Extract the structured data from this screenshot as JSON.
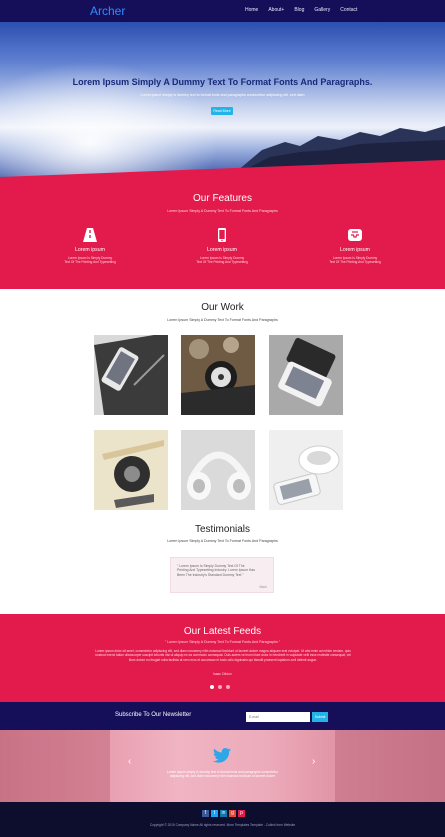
{
  "nav": {
    "logo": "Archer",
    "items": [
      "Home",
      "About+",
      "Blog",
      "Gallery",
      "Contact"
    ]
  },
  "hero": {
    "title": "Lorem Ipsum Simply A Dummy Text To Format Fonts And Paragraphs.",
    "subtitle": "Lorem ipsum simply is dummy text to format fonts and paragraphs consectetur adipiscing elit, sed diam",
    "button": "Read More"
  },
  "features": {
    "title": "Our Features",
    "subtitle": "Lorem Ipsum Simply A Dummy Text To Format Fonts And Paragraphs",
    "items": [
      {
        "icon": "road-icon",
        "title": "Lorem ipsum",
        "desc_line1": "Lorem Ipsum Is Simply Dummy",
        "desc_line2": "Text Of The Printing And Typesetting"
      },
      {
        "icon": "mobile-icon",
        "title": "Lorem ipsum",
        "desc_line1": "Lorem Ipsum Is Simply Dummy",
        "desc_line2": "Text Of The Printing And Typesetting"
      },
      {
        "icon": "inbox-icon",
        "title": "Lorem ipsum",
        "desc_line1": "Lorem Ipsum Is Simply Dummy",
        "desc_line2": "Text Of The Printing And Typesetting"
      }
    ]
  },
  "work": {
    "title": "Our Work",
    "subtitle": "Lorem Ipsum Simply A Dummy Text To Format Fonts And Paragraphs"
  },
  "testimonials": {
    "title": "Testimonials",
    "subtitle": "Lorem Ipsum Simply A Dummy Text To Format Fonts And Paragraphs",
    "quote": "\" Lorem Ipsum Is Simply Dummy Text Of The Printing And Typesetting Industry. Lorem Ipsum Has Been The Industry's Standard Dummy Text \"",
    "author": "Mark"
  },
  "feeds": {
    "title": "Our Latest Feeds",
    "subtitle": "\" Lorem Ipsum Simply A Dummy Text To Format Fonts And Paragraphs \"",
    "body": "Lorem ipsum dolor sit amet, consectetur adipiscing elit, sed diam nonummy nibh euismod tincidunt ut laoreet dolore magna aliquam erat volutpat. Ut wisi enim ad minim veniam, quis nostrud exerci tation ullamcorper suscipit lobortis nisl ut aliquip ex ea commodo consequat. Duis autem vel eum iriure dolor in hendrerit in vulputate velit esse molestie consequat, vel illum dolore eu feugiat nulla facilisis at vero eros et accumsan et iusto odio dignissim qui blandit praesent luptatum zzril delenit augue.",
    "small": "Isaac Clinton"
  },
  "newsletter": {
    "label": "Subscribe To Our Newsletter",
    "placeholder": "E-mail",
    "button": "Submit"
  },
  "tweets": {
    "text_line1": "Lorem ipsum simply is dummy text to format fonts and paragraphs consectetur",
    "text_line2": "adipiscing elit, sed diam nonummy nibh euismod tincidunt ut laoreet dolore"
  },
  "footer": {
    "copyright": "Copyright © 2015 Company Name All rights reserved. More Templates Template - Collect from Website"
  },
  "colors": {
    "nav": "#150f5a",
    "accent": "#e31b4c",
    "button": "#23b3e6"
  }
}
